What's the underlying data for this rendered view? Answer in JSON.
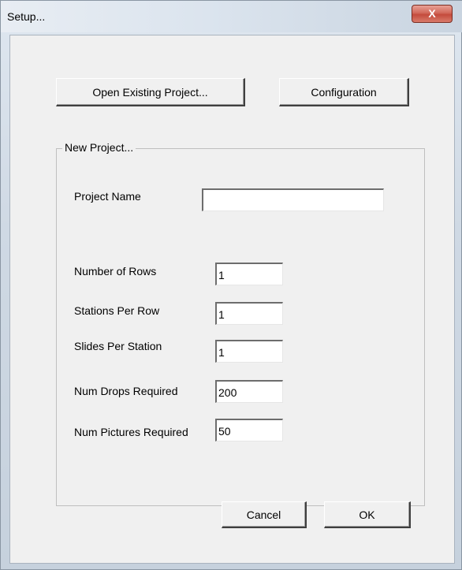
{
  "window": {
    "title": "Setup...",
    "close_glyph": "X"
  },
  "buttons": {
    "open_existing": "Open Existing Project...",
    "configuration": "Configuration",
    "cancel": "Cancel",
    "ok": "OK"
  },
  "new_project": {
    "group_title": "New Project...",
    "fields": {
      "project_name": {
        "label": "Project Name",
        "value": ""
      },
      "num_rows": {
        "label": "Number of Rows",
        "value": "1"
      },
      "stations_per_row": {
        "label": "Stations Per Row",
        "value": "1"
      },
      "slides_per_station": {
        "label": "Slides Per Station",
        "value": "1"
      },
      "num_drops": {
        "label": "Num Drops Required",
        "value": "200"
      },
      "num_pictures": {
        "label": "Num Pictures  Required",
        "value": "50"
      }
    }
  },
  "colors": {
    "dialog_bg": "#f0f0f0",
    "close_red": "#c44b3c"
  }
}
